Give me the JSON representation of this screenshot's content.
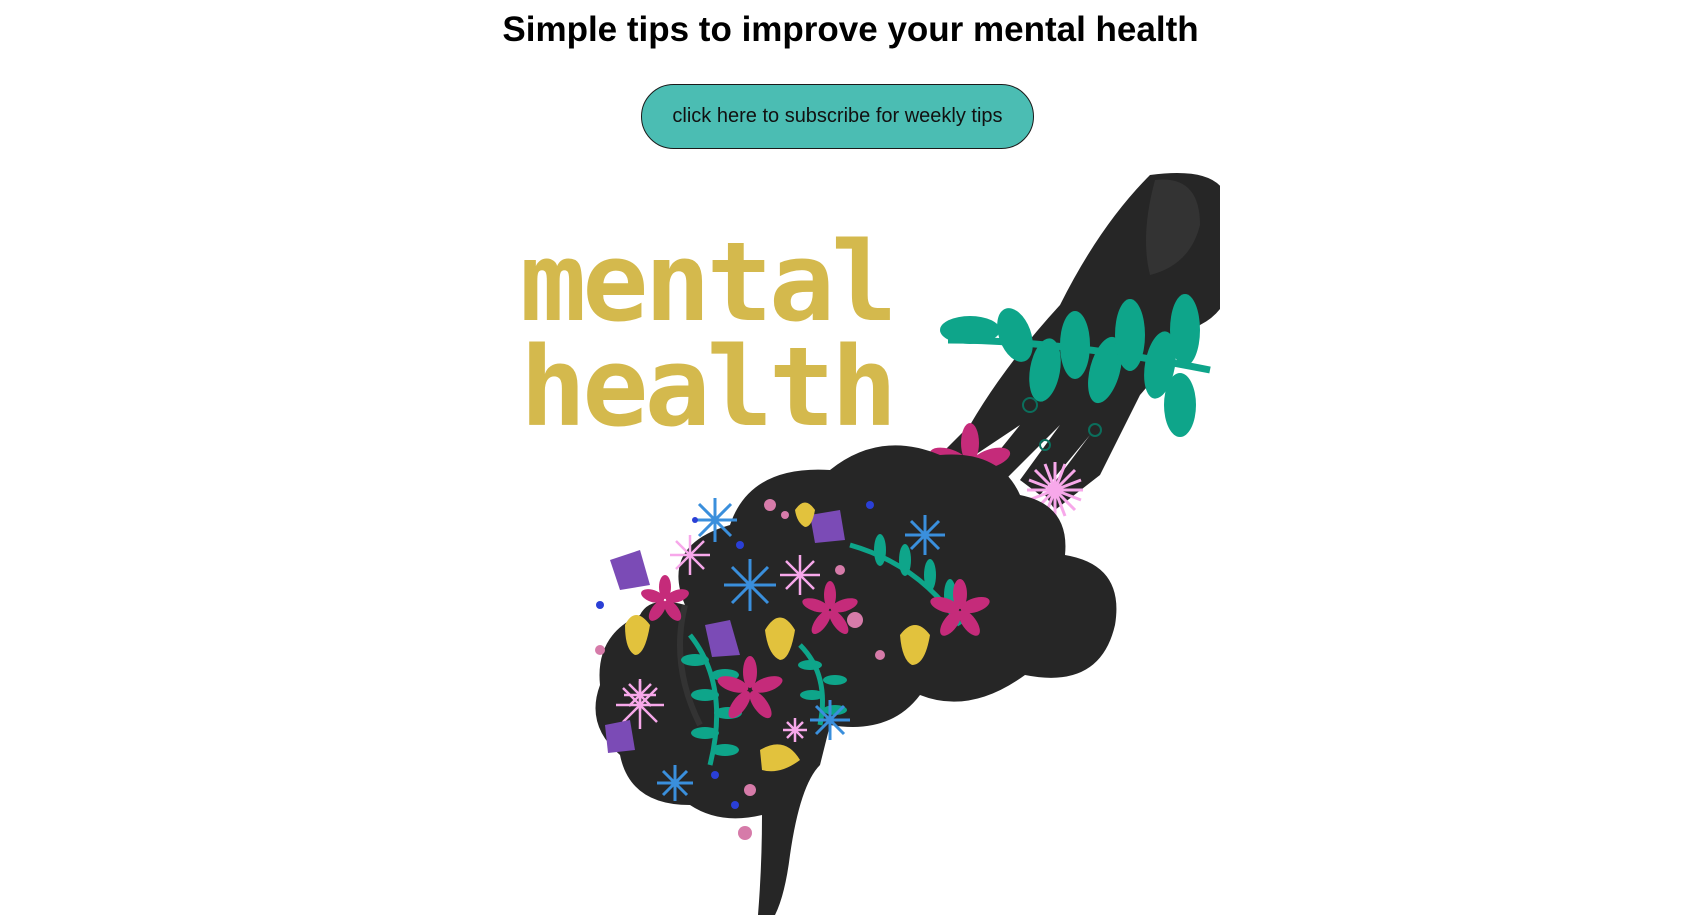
{
  "page": {
    "title": "Simple tips to improve your mental health"
  },
  "subscribe": {
    "label": "click here to subscribe for weekly tips",
    "color": "#4bbdb3"
  },
  "illustration": {
    "lettering": [
      "mental",
      "health"
    ],
    "colors": {
      "lettering": "#d4b94d",
      "silhouette": "#262626",
      "leaf": "#0ea58a",
      "magenta": "#c52b7a",
      "pink": "#f7a8ea",
      "blue": "#3a8fdc",
      "purple": "#7b4bb6",
      "yellow": "#e2c23d"
    }
  }
}
